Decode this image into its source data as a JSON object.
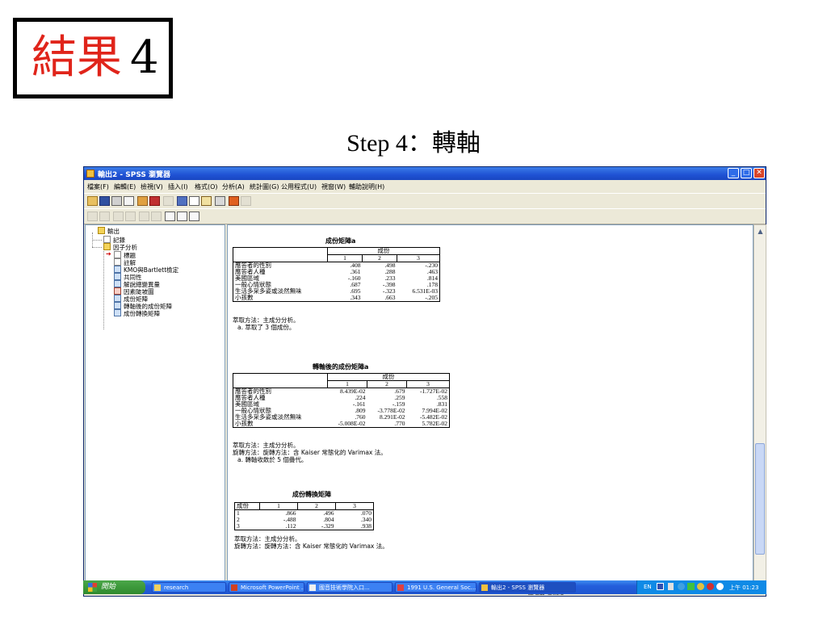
{
  "slide": {
    "title_cn": "結果",
    "title_num": "4",
    "step_title": "Step 4：轉軸"
  },
  "window": {
    "title": "輸出2 - SPSS 瀏覽器",
    "buttons": {
      "minimize": "_",
      "maximize": "□",
      "close": "✕"
    },
    "menu": [
      "檔案(F)",
      "編輯(E)",
      "檢視(V)",
      "插入(I)",
      "格式(O)",
      "分析(A)",
      "統計圖(G)",
      "公用程式(U)",
      "視窗(W)",
      "輔助說明(H)"
    ],
    "status_text": "SPSS 處理器  已就緒"
  },
  "tree": {
    "root": "輸出",
    "items": [
      "記錄",
      "因子分析",
      "標題",
      "註解",
      "KMO與Bartlett檢定",
      "共同性",
      "解說總變異量",
      "因素陡坡圖",
      "成份矩陣",
      "轉軸後的成份矩陣",
      "成份轉換矩陣"
    ]
  },
  "component_matrix": {
    "title": "成份矩陣a",
    "header": "成份",
    "cols": [
      "1",
      "2",
      "3"
    ],
    "rows": [
      {
        "label": "應答者的性別",
        "v": [
          ".408",
          ".498",
          "-.230"
        ]
      },
      {
        "label": "應答者人種",
        "v": [
          ".361",
          ".288",
          ".463"
        ]
      },
      {
        "label": "美國區域",
        "v": [
          "-.160",
          ".233",
          ".814"
        ]
      },
      {
        "label": "一般心情狀態",
        "v": [
          ".687",
          "-.398",
          ".178"
        ]
      },
      {
        "label": "生活多采多姿或淡然無味",
        "v": [
          ".695",
          "-.323",
          "6.531E-03"
        ]
      },
      {
        "label": "小孩數",
        "v": [
          ".343",
          ".663",
          "-.205"
        ]
      }
    ],
    "note1": "萃取方法：主成分分析。",
    "note2": "a. 萃取了 3 個成份。"
  },
  "rotated_matrix": {
    "title": "轉軸後的成份矩陣a",
    "header": "成份",
    "cols": [
      "1",
      "2",
      "3"
    ],
    "rows": [
      {
        "label": "應答者的性別",
        "v": [
          "8.439E-02",
          ".679",
          "-1.727E-02"
        ]
      },
      {
        "label": "應答者人種",
        "v": [
          ".224",
          ".259",
          ".558"
        ]
      },
      {
        "label": "美國區域",
        "v": [
          "-.161",
          "-.159",
          ".831"
        ]
      },
      {
        "label": "一般心情狀態",
        "v": [
          ".809",
          "-3.778E-02",
          "7.994E-02"
        ]
      },
      {
        "label": "生活多采多姿或淡然無味",
        "v": [
          ".760",
          "8.291E-02",
          "-5.482E-02"
        ]
      },
      {
        "label": "小孩數",
        "v": [
          "-5.008E-02",
          ".770",
          "5.782E-02"
        ]
      }
    ],
    "note1": "萃取方法：主成分分析。",
    "note2": "旋轉方法：旋轉方法：含 Kaiser 常態化的 Varimax 法。",
    "note3": "a. 轉軸收斂於 5 個疊代。"
  },
  "transform_matrix": {
    "title": "成份轉換矩陣",
    "cols": [
      "成份",
      "1",
      "2",
      "3"
    ],
    "rows": [
      {
        "label": "1",
        "v": [
          ".866",
          ".496",
          ".070"
        ]
      },
      {
        "label": "2",
        "v": [
          "-.488",
          ".804",
          ".340"
        ]
      },
      {
        "label": "3",
        "v": [
          ".112",
          "-.329",
          ".938"
        ]
      }
    ],
    "note1": "萃取方法：主成分分析。",
    "note2": "旋轉方法：旋轉方法：含 Kaiser 常態化的 Varimax 法。"
  },
  "taskbar": {
    "start": "開始",
    "tasks": [
      "research",
      "Microsoft PowerPoint ...",
      "國音技術學院入口...",
      "1991 U.S. General Soc...",
      "輸出2 - SPSS 瀏覽器"
    ],
    "lang": "EN",
    "clock": "上午 01:23"
  }
}
